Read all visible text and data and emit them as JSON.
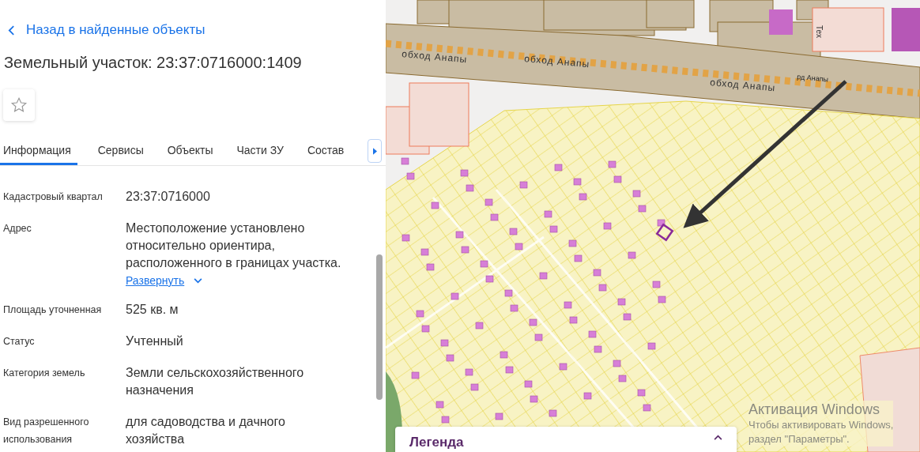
{
  "back_link": {
    "label": "Назад в найденные объекты"
  },
  "title": "Земельный участок: 23:37:0716000:1409",
  "favorite": {
    "checked": false
  },
  "tabs": [
    {
      "label": "Информация",
      "selected": true
    },
    {
      "label": "Сервисы",
      "selected": false
    },
    {
      "label": "Объекты",
      "selected": false
    },
    {
      "label": "Части ЗУ",
      "selected": false
    },
    {
      "label": "Состав",
      "selected": false
    }
  ],
  "fields": [
    {
      "label": [
        "Кадастровый квартал"
      ],
      "value": [
        "23:37:0716000"
      ]
    },
    {
      "label": [
        "Адрес"
      ],
      "value": [
        "Местоположение установлено",
        "относительно ориентира,",
        "расположенного в границах участка."
      ],
      "expand_link": "Развернуть"
    },
    {
      "label": [
        "Площадь уточненная"
      ],
      "value": [
        "525 кв. м"
      ]
    },
    {
      "label": [
        "Статус"
      ],
      "value": [
        "Учтенный"
      ]
    },
    {
      "label": [
        "Категория земель"
      ],
      "value": [
        "Земли сельскохозяйственного",
        "назначения"
      ]
    },
    {
      "label": [
        "Вид разрешенного",
        "использования"
      ],
      "value": [
        "для садоводства и дачного",
        "хозяйства"
      ]
    }
  ],
  "map": {
    "labels": [
      {
        "text": "обход Анапы",
        "kind": "road"
      },
      {
        "text": "обход Анапы",
        "kind": "road"
      },
      {
        "text": "обход Анапы",
        "kind": "road"
      },
      {
        "text": "рд Анапы",
        "kind": "small"
      },
      {
        "text": "Тех",
        "kind": "vertical"
      }
    ],
    "legend": {
      "title": "Легенда"
    }
  },
  "os_notice": {
    "title": "Активация Windows",
    "lines": [
      "Чтобы активировать Windows,",
      "раздел \"Параметры\"."
    ]
  }
}
